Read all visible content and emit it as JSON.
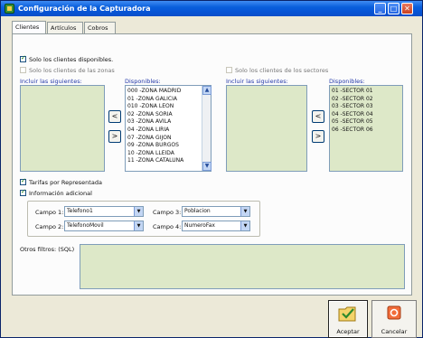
{
  "window": {
    "title": "Configuración de la Capturadora",
    "controls": [
      "minimize-icon",
      "maximize-icon",
      "close-icon"
    ]
  },
  "tabs": [
    "Clientes",
    "Artículos",
    "Cobros"
  ],
  "active_tab": "Clientes",
  "options": {
    "solo_disponibles": {
      "label": "Solo los clientes disponibles.",
      "checked": true
    },
    "solo_zonas": {
      "label": "Solo los clientes de las zonas",
      "checked": false
    },
    "solo_sectores": {
      "label": "Solo los clientes de los sectores",
      "checked": false
    },
    "tarifas": {
      "label": "Tarifas por Representada",
      "checked": true
    },
    "info_adicional": {
      "label": "Información adicional",
      "checked": true
    }
  },
  "zonas": {
    "incluir_label": "Incluir las siguientes:",
    "disponibles_label": "Disponibles:",
    "disponibles": [
      "000 -ZONA MADRID",
      "01 -ZONA GALICIA",
      "010 -ZONA LEON",
      "02 -ZONA SORIA",
      "03 -ZONA AVILA",
      "04 -ZONA LIRIA",
      "07 -ZONA GIJON",
      "09 -ZONA BURGOS",
      "10 -ZONA LLEIDA",
      "11 -ZONA CATALUÑA"
    ]
  },
  "sectores": {
    "incluir_label": "Incluir las siguientes:",
    "disponibles_label": "Disponibles:",
    "disponibles": [
      "01 -SECTOR 01",
      "02 -SECTOR 02",
      "03 -SECTOR 03",
      "04 -SECTOR 04",
      "05 -SECTOR 05",
      "06 -SECTOR 06"
    ]
  },
  "move_buttons": {
    "add": "<",
    "remove": ">"
  },
  "campos": [
    {
      "label": "Campo 1:",
      "value": "Telefono1"
    },
    {
      "label": "Campo 2:",
      "value": "TelefonoMovil"
    },
    {
      "label": "Campo 3:",
      "value": "Poblacion"
    },
    {
      "label": "Campo 4:",
      "value": "NumeroFax"
    }
  ],
  "otros_filtros_label": "Otros filtros: (SQL)",
  "buttons": {
    "aceptar": "Aceptar",
    "cancelar": "Cancelar"
  }
}
